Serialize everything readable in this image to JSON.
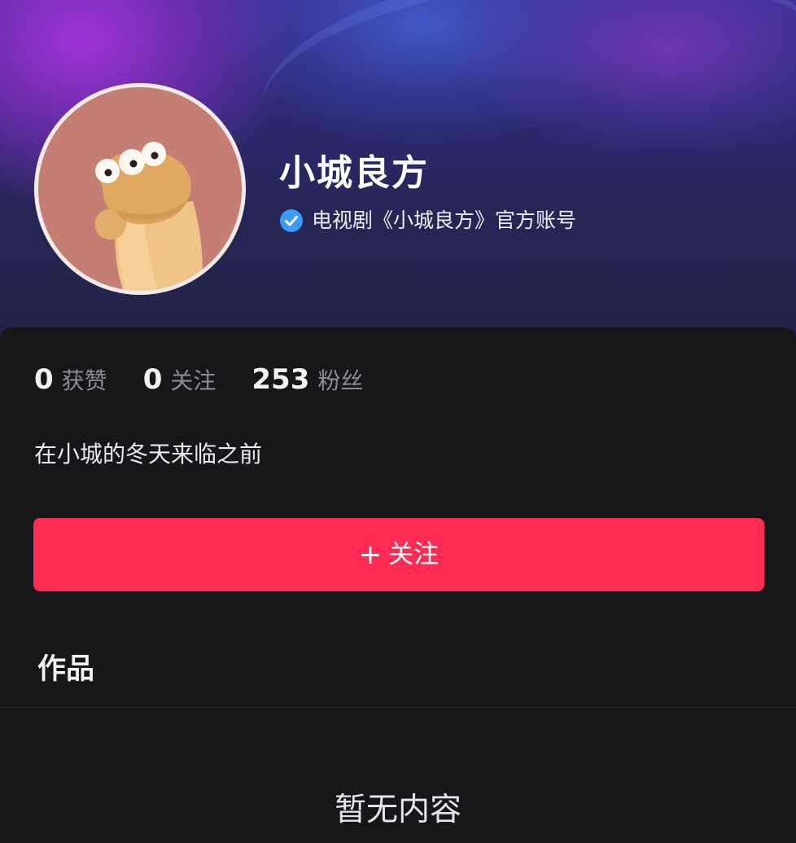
{
  "profile": {
    "name": "小城良方",
    "verification_text": "电视剧《小城良方》官方账号",
    "bio": "在小城的冬天来临之前"
  },
  "stats": [
    {
      "value": "0",
      "label": "获赞"
    },
    {
      "value": "0",
      "label": "关注"
    },
    {
      "value": "253",
      "label": "粉丝"
    }
  ],
  "actions": {
    "follow_plus": "+",
    "follow_label": "关注"
  },
  "tabs": {
    "works_label": "作品"
  },
  "content": {
    "empty_text": "暂无内容"
  },
  "icons": {
    "verified": "verified-check-icon",
    "avatar": "cartoon-avatar"
  },
  "colors": {
    "accent": "#fe2c55",
    "verified_badge": "#3b9cf7",
    "background": "#171719"
  }
}
